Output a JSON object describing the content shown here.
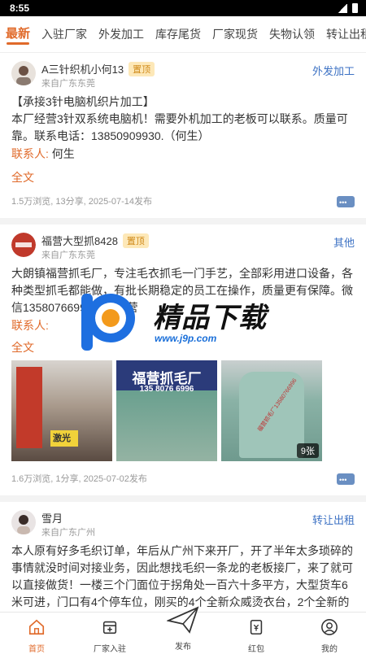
{
  "status_bar": {
    "time": "8:55"
  },
  "tabs": [
    "最新",
    "入驻厂家",
    "外发加工",
    "库存尾货",
    "厂家现货",
    "失物认领",
    "转让出租"
  ],
  "posts": [
    {
      "user": "A三针织机小何13",
      "pinned": "置顶",
      "from": "来自广东东莞",
      "category": "外发加工",
      "body": "【承接3针电脑机织片加工】\n本厂经营3针双系统电脑机！需要外机加工的老板可以联系。质量可靠。联系电话：13850909930.（何生）",
      "contact_label": "联系人:",
      "contact_name": "何生",
      "full_text": "全文",
      "meta": "1.5万浏览, 13分享, 2025-07-14发布"
    },
    {
      "user": "福营大型抓8428",
      "pinned": "置顶",
      "from": "来自广东东莞",
      "category": "其他",
      "body": "大朗镇福营抓毛厂，专注毛衣抓毛一门手艺，全部彩用进口设备，各种类型抓毛都能做，有批长期稳定的员工在操作，质量更有保障。微信13580766996认准福营",
      "contact_label": "联系人:",
      "contact_name": "",
      "full_text": "全文",
      "image_banner": "福营抓毛厂",
      "image_phone": "135 8076 6996",
      "image_sign": "激光",
      "image_watermark": "福营抓毛厂13580766996",
      "image_count": "9张",
      "meta": "1.6万浏览, 1分享, 2025-07-02发布"
    },
    {
      "user": "雪月",
      "from": "来自广东广州",
      "category": "转让出租",
      "body": "本人原有好多毛织订单，年后从广州下来开厂，开了半年太多琐碎的事情就没时间对接业务，因此想找毛织一条龙的老板接厂，来了就可以直接做货！一楼三个门面位于拐角处一百六十多平方，大型货车6米可进，门口有4个停车位，刚买的4个全新众威烫衣台，2个全新的平车和…（最新款），花了两万多买了"
    }
  ],
  "watermark_logo": {
    "title": "精品下载",
    "url": "www.j9p.com"
  },
  "bottom_nav": [
    {
      "label": "首页",
      "icon": "home-icon"
    },
    {
      "label": "厂家入驻",
      "icon": "store-icon"
    },
    {
      "label": "发布",
      "icon": "paper-plane-icon"
    },
    {
      "label": "红包",
      "icon": "red-envelope-icon"
    },
    {
      "label": "我的",
      "icon": "user-icon"
    }
  ],
  "colors": {
    "accent": "#e06a2a",
    "category": "#3d72c4",
    "pin_bg": "#fde8b8"
  }
}
